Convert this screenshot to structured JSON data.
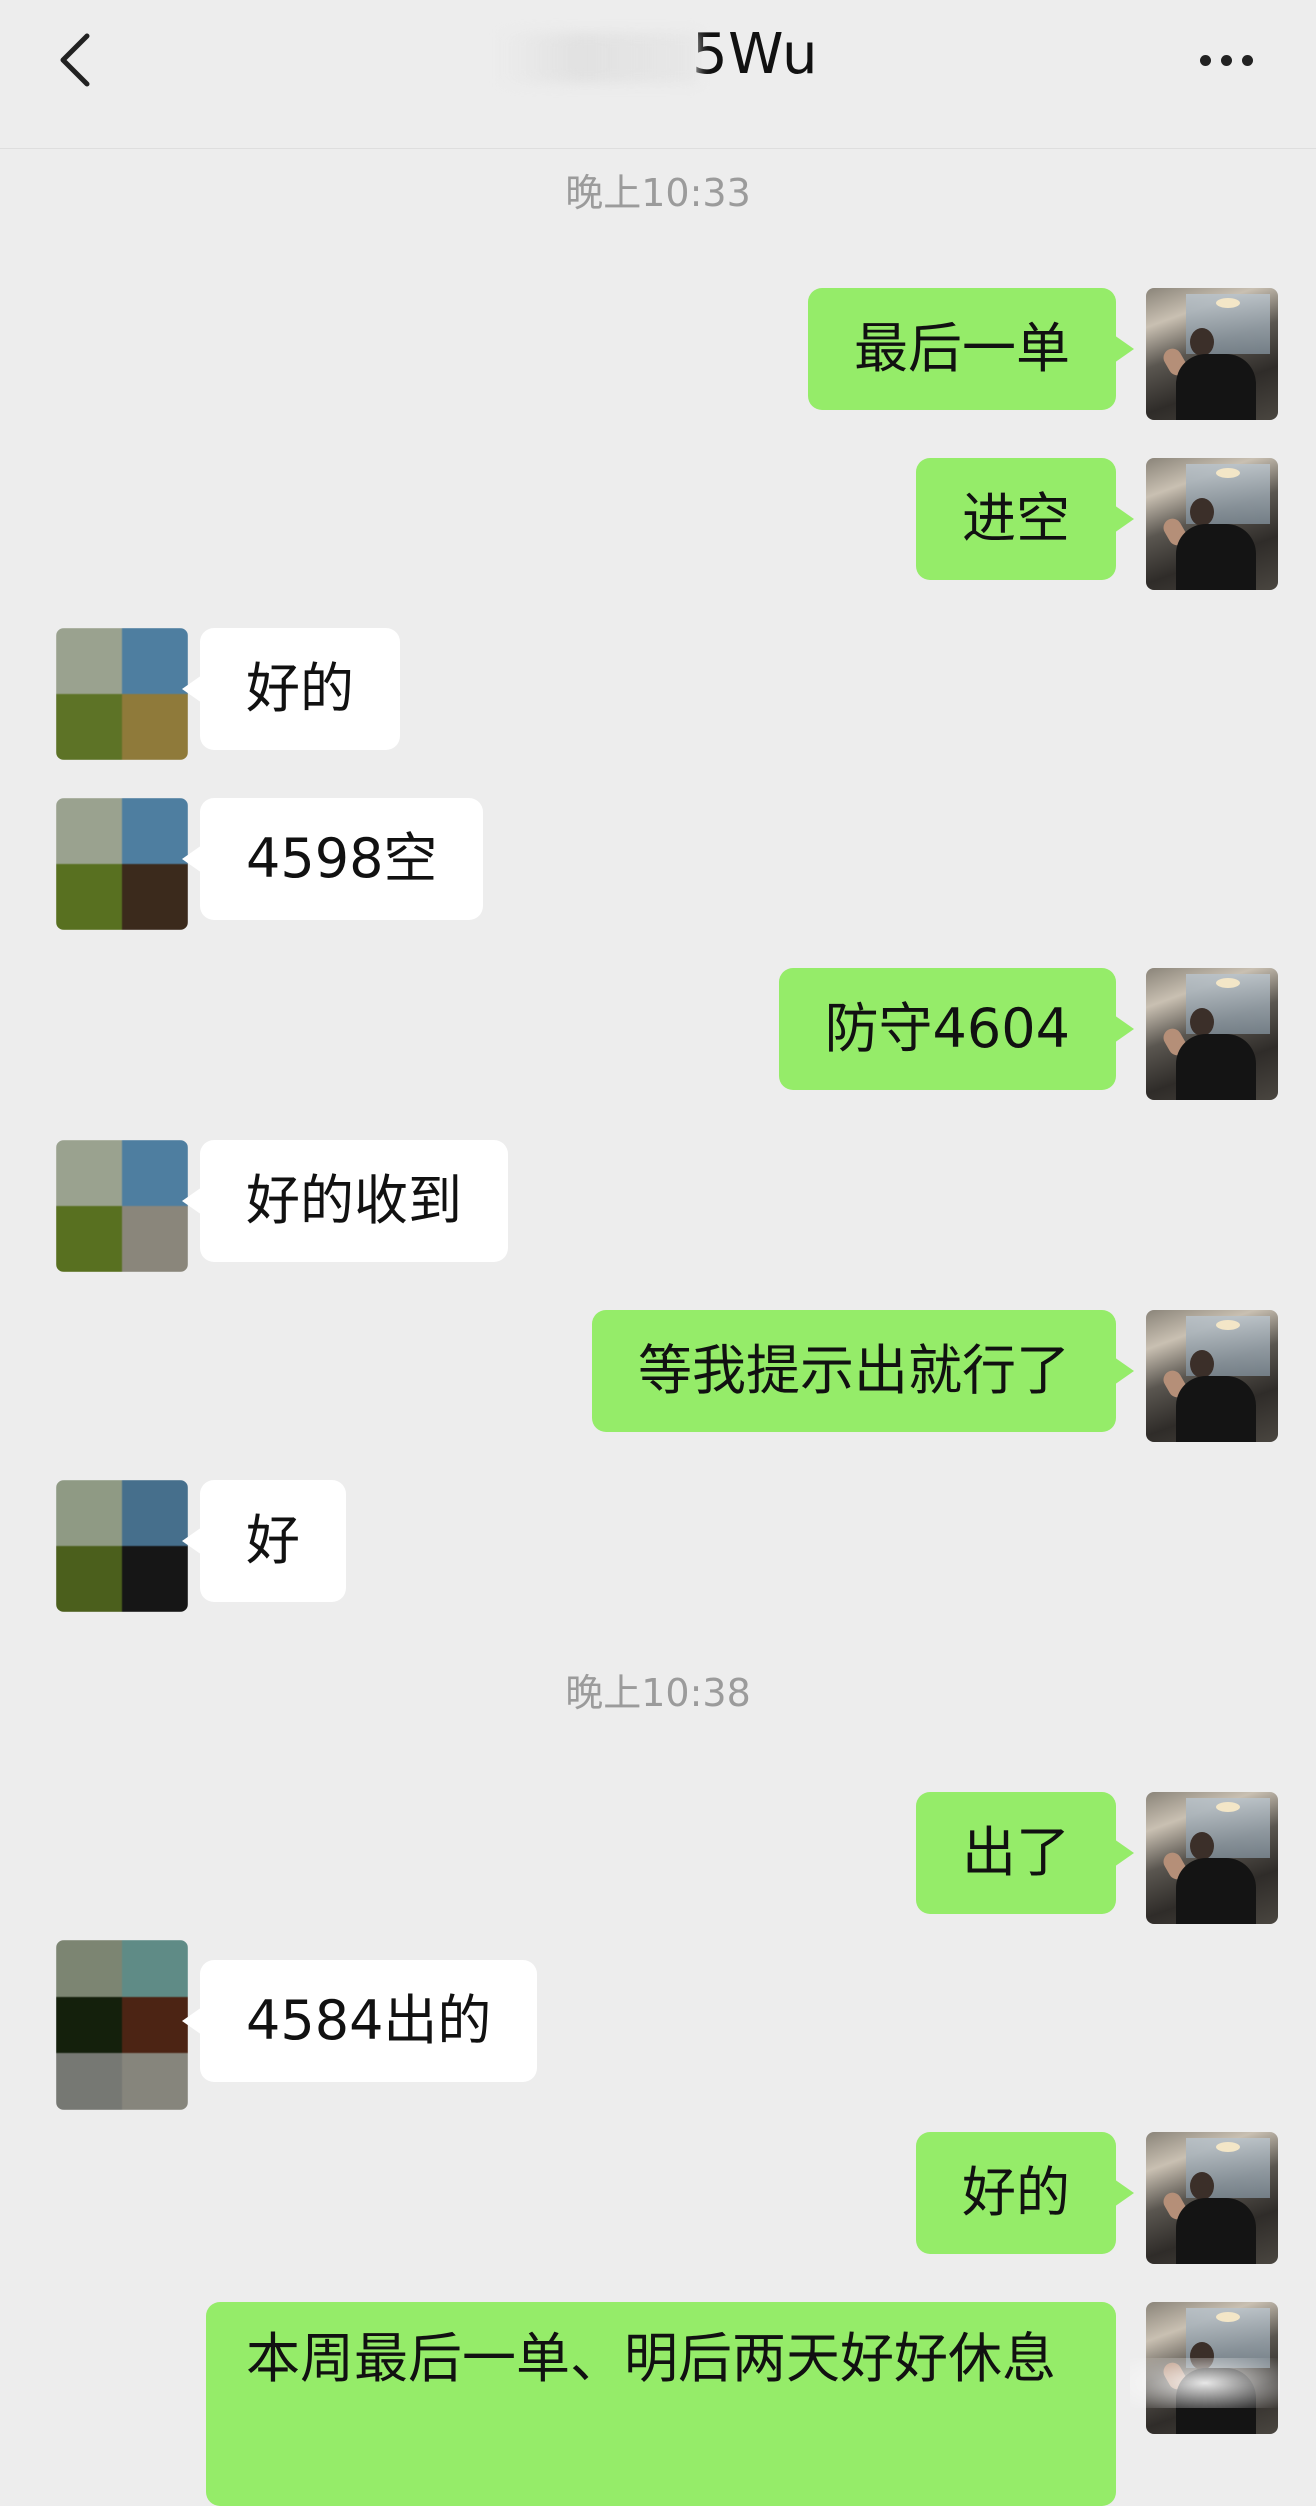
{
  "header": {
    "title": "5Wu",
    "back_icon": "chevron-left-icon",
    "more_icon": "more-dots-icon"
  },
  "timestamps": [
    "晚上10:33",
    "晚上10:38"
  ],
  "messages": [
    {
      "sender": "me",
      "text": "最后一单"
    },
    {
      "sender": "me",
      "text": "进空"
    },
    {
      "sender": "other",
      "text": "好的"
    },
    {
      "sender": "other",
      "text": "4598空"
    },
    {
      "sender": "me",
      "text": "防守4604"
    },
    {
      "sender": "other",
      "text": "好的收到"
    },
    {
      "sender": "me",
      "text": "等我提示出就行了"
    },
    {
      "sender": "other",
      "text": "好"
    },
    {
      "sender": "me",
      "text": "出了"
    },
    {
      "sender": "other",
      "text": "4584出的"
    },
    {
      "sender": "me",
      "text": "好的"
    },
    {
      "sender": "me",
      "text": "本周最后一单、明后两天好好休息"
    }
  ],
  "colors": {
    "background": "#ededed",
    "my_bubble": "#95ec69",
    "their_bubble": "#ffffff",
    "timestamp_text": "#9b9b9b"
  }
}
